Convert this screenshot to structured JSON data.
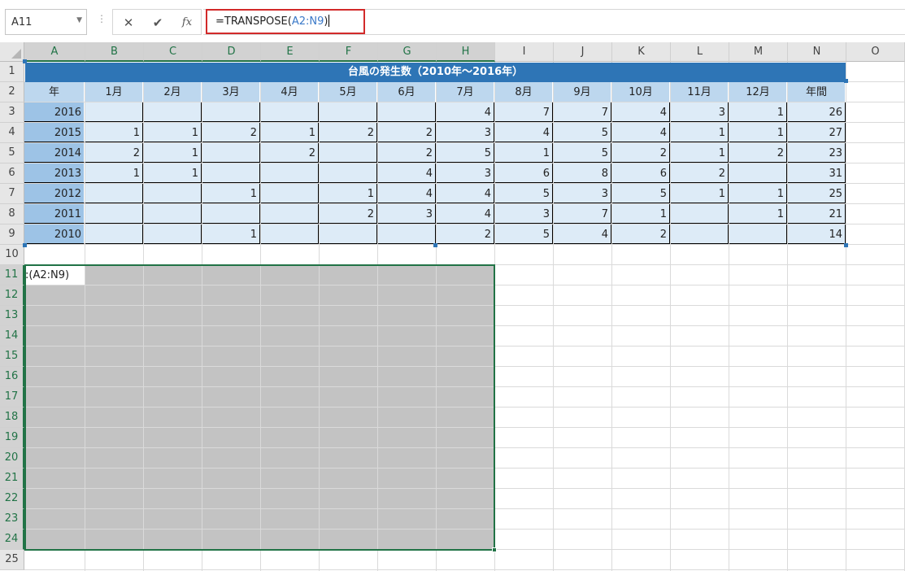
{
  "formula_bar": {
    "name_box": "A11",
    "cancel_icon": "✕",
    "enter_icon": "✔",
    "fx_label": "fx",
    "formula_prefix": "=TRANSPOSE(",
    "formula_ref": "A2:N9",
    "formula_suffix": ")"
  },
  "columns": [
    "A",
    "B",
    "C",
    "D",
    "E",
    "F",
    "G",
    "H",
    "I",
    "J",
    "K",
    "L",
    "M",
    "N",
    "O"
  ],
  "rows": [
    "1",
    "2",
    "3",
    "4",
    "5",
    "6",
    "7",
    "8",
    "9",
    "10",
    "11",
    "12",
    "13",
    "14",
    "15",
    "16",
    "17",
    "18",
    "19",
    "20",
    "21",
    "22",
    "23",
    "24",
    "25"
  ],
  "table": {
    "title": "台風の発生数（2010年～2016年）",
    "headers": [
      "年",
      "1月",
      "2月",
      "3月",
      "4月",
      "5月",
      "6月",
      "7月",
      "8月",
      "9月",
      "10月",
      "11月",
      "12月",
      "年間"
    ],
    "data": [
      [
        "2016",
        "",
        "",
        "",
        "",
        "",
        "",
        "4",
        "7",
        "7",
        "4",
        "3",
        "1",
        "26"
      ],
      [
        "2015",
        "1",
        "1",
        "2",
        "1",
        "2",
        "2",
        "3",
        "4",
        "5",
        "4",
        "1",
        "1",
        "27"
      ],
      [
        "2014",
        "2",
        "1",
        "",
        "2",
        "",
        "2",
        "5",
        "1",
        "5",
        "2",
        "1",
        "2",
        "23"
      ],
      [
        "2013",
        "1",
        "1",
        "",
        "",
        "",
        "4",
        "3",
        "6",
        "8",
        "6",
        "2",
        "",
        "31"
      ],
      [
        "2012",
        "",
        "",
        "1",
        "",
        "1",
        "4",
        "4",
        "5",
        "3",
        "5",
        "1",
        "1",
        "25"
      ],
      [
        "2011",
        "",
        "",
        "",
        "",
        "2",
        "3",
        "4",
        "3",
        "7",
        "1",
        "",
        "1",
        "21"
      ],
      [
        "2010",
        "",
        "",
        "1",
        "",
        "",
        "",
        "2",
        "5",
        "4",
        "2",
        "",
        "",
        "14"
      ]
    ]
  },
  "active_cell_text": ":(A2:N9)",
  "colors": {
    "table_title_bg": "#2e75b6",
    "header_bg": "#bdd7ee",
    "year_col_bg": "#9dc3e6",
    "data_bg": "#ddebf7",
    "selection_fill": "#c3c3c3",
    "selection_border": "#217346",
    "formula_highlight": "#d22a2a"
  }
}
